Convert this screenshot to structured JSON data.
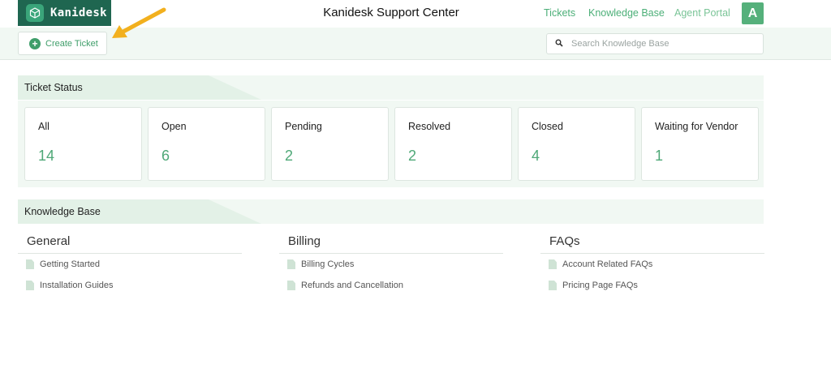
{
  "header": {
    "brand": "Kanidesk",
    "title": "Kanidesk Support Center",
    "nav": [
      {
        "label": "Tickets"
      },
      {
        "label": "Knowledge Base"
      },
      {
        "label": "Agent Portal"
      }
    ],
    "avatar_letter": "A"
  },
  "toolbar": {
    "create_label": "Create Ticket",
    "search_placeholder": "Search Knowledge Base"
  },
  "ticket_status": {
    "title": "Ticket Status",
    "cards": [
      {
        "label": "All",
        "count": "14"
      },
      {
        "label": "Open",
        "count": "6"
      },
      {
        "label": "Pending",
        "count": "2"
      },
      {
        "label": "Resolved",
        "count": "2"
      },
      {
        "label": "Closed",
        "count": "4"
      },
      {
        "label": "Waiting for Vendor",
        "count": "1"
      }
    ]
  },
  "knowledge_base": {
    "title": "Knowledge Base",
    "categories": [
      {
        "name": "General",
        "articles": [
          "Getting Started",
          "Installation Guides"
        ]
      },
      {
        "name": "Billing",
        "articles": [
          "Billing Cycles",
          "Refunds and Cancellation"
        ]
      },
      {
        "name": "FAQs",
        "articles": [
          "Account Related FAQs",
          "Pricing Page FAQs"
        ]
      }
    ]
  },
  "colors": {
    "brand": "#1f6650",
    "accent": "#4caf78",
    "panel": "#f1f8f3",
    "annotation_arrow": "#f2b01e"
  }
}
